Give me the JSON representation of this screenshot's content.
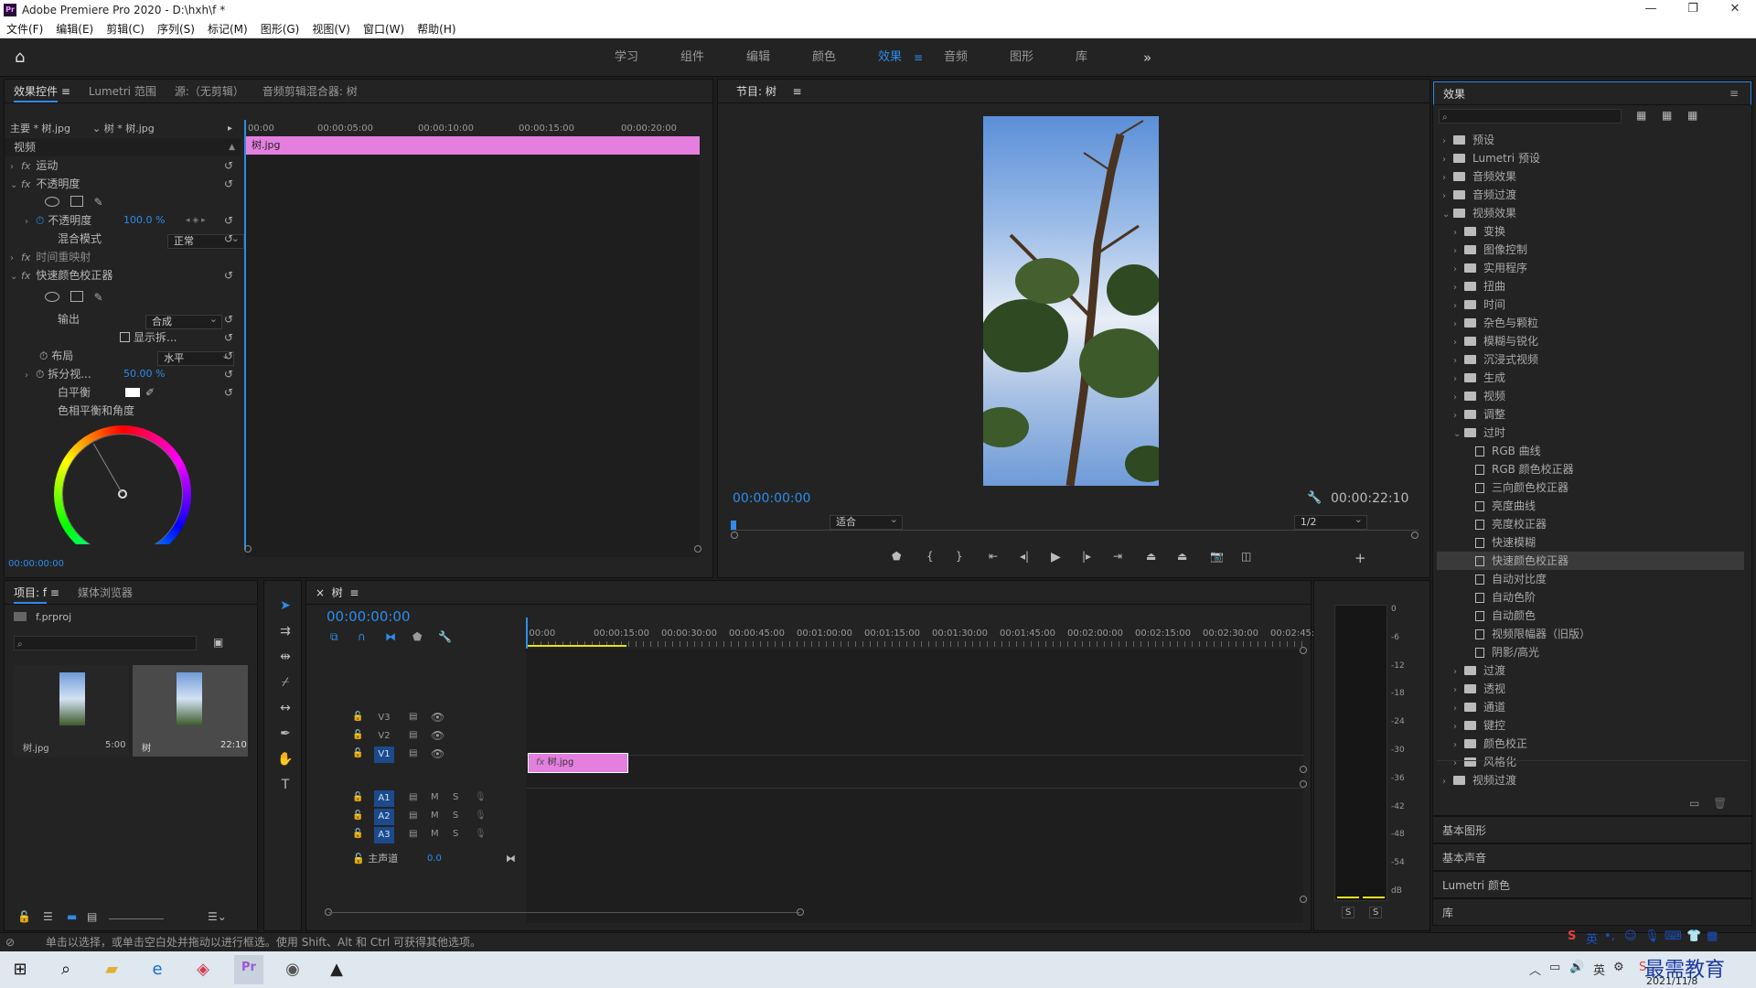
{
  "app": {
    "title": "Adobe Premiere Pro 2020 - D:\\hxh\\f *",
    "icon": "Pr"
  },
  "window_buttons": [
    "—",
    "❐",
    "✕"
  ],
  "menu": [
    "文件(F)",
    "编辑(E)",
    "剪辑(C)",
    "序列(S)",
    "标记(M)",
    "图形(G)",
    "视图(V)",
    "窗口(W)",
    "帮助(H)"
  ],
  "workspaces": {
    "items": [
      "学习",
      "组件",
      "编辑",
      "颜色",
      "效果",
      "音频",
      "图形",
      "库"
    ],
    "active": "效果",
    "more": "»"
  },
  "effect_controls": {
    "tabs": [
      "效果控件",
      "Lumetri 范围",
      "源:（无剪辑）",
      "音频剪辑混合器: 树"
    ],
    "master": "主要 * 树.jpg",
    "clip": "树 * 树.jpg",
    "ruler": [
      "00:00",
      "00:00:05:00",
      "00:00:10:00",
      "00:00:15:00",
      "00:00:20:00"
    ],
    "clip_bar": "树.jpg",
    "section_video": "视频",
    "motion": "运动",
    "opacity": "不透明度",
    "opacity_prop": "不透明度",
    "opacity_value": "100.0 %",
    "blend_mode_label": "混合模式",
    "blend_mode": "正常",
    "time_remap": "时间重映射",
    "fast_color": "快速颜色校正器",
    "output_label": "输出",
    "output_value": "合成",
    "show_split": "显示拆...",
    "layout_label": "布局",
    "layout_value": "水平",
    "split_label": "拆分视...",
    "split_value": "50.00 %",
    "white_balance": "白平衡",
    "hue_balance": "色相平衡和角度",
    "timecode": "00:00:00:00",
    "fx": "fx"
  },
  "program": {
    "title": "节目: 树",
    "timecode": "00:00:00:00",
    "fit": "适合",
    "quality": "1/2",
    "duration": "00:00:22:10"
  },
  "effects_panel": {
    "title": "效果",
    "search_placeholder": "",
    "items": [
      {
        "label": "预设",
        "level": 0,
        "type": "folder"
      },
      {
        "label": "Lumetri 预设",
        "level": 0,
        "type": "folder"
      },
      {
        "label": "音频效果",
        "level": 0,
        "type": "folder"
      },
      {
        "label": "音频过渡",
        "level": 0,
        "type": "folder"
      },
      {
        "label": "视频效果",
        "level": 0,
        "type": "folder",
        "open": true
      },
      {
        "label": "变换",
        "level": 1,
        "type": "folder"
      },
      {
        "label": "图像控制",
        "level": 1,
        "type": "folder"
      },
      {
        "label": "实用程序",
        "level": 1,
        "type": "folder"
      },
      {
        "label": "扭曲",
        "level": 1,
        "type": "folder"
      },
      {
        "label": "时间",
        "level": 1,
        "type": "folder"
      },
      {
        "label": "杂色与颗粒",
        "level": 1,
        "type": "folder"
      },
      {
        "label": "模糊与锐化",
        "level": 1,
        "type": "folder"
      },
      {
        "label": "沉浸式视频",
        "level": 1,
        "type": "folder"
      },
      {
        "label": "生成",
        "level": 1,
        "type": "folder"
      },
      {
        "label": "视频",
        "level": 1,
        "type": "folder"
      },
      {
        "label": "调整",
        "level": 1,
        "type": "folder"
      },
      {
        "label": "过时",
        "level": 1,
        "type": "folder",
        "open": true
      },
      {
        "label": "RGB 曲线",
        "level": 2,
        "type": "file"
      },
      {
        "label": "RGB 颜色校正器",
        "level": 2,
        "type": "file"
      },
      {
        "label": "三向颜色校正器",
        "level": 2,
        "type": "file"
      },
      {
        "label": "亮度曲线",
        "level": 2,
        "type": "file"
      },
      {
        "label": "亮度校正器",
        "level": 2,
        "type": "file"
      },
      {
        "label": "快速模糊",
        "level": 2,
        "type": "file"
      },
      {
        "label": "快速颜色校正器",
        "level": 2,
        "type": "file",
        "highlight": true
      },
      {
        "label": "自动对比度",
        "level": 2,
        "type": "file"
      },
      {
        "label": "自动色阶",
        "level": 2,
        "type": "file"
      },
      {
        "label": "自动颜色",
        "level": 2,
        "type": "file"
      },
      {
        "label": "视频限幅器（旧版）",
        "level": 2,
        "type": "file"
      },
      {
        "label": "阴影/高光",
        "level": 2,
        "type": "file"
      },
      {
        "label": "过渡",
        "level": 1,
        "type": "folder"
      },
      {
        "label": "透视",
        "level": 1,
        "type": "folder"
      },
      {
        "label": "通道",
        "level": 1,
        "type": "folder"
      },
      {
        "label": "键控",
        "level": 1,
        "type": "folder"
      },
      {
        "label": "颜色校正",
        "level": 1,
        "type": "folder"
      },
      {
        "label": "风格化",
        "level": 1,
        "type": "folder"
      },
      {
        "label": "视频过渡",
        "level": 0,
        "type": "folder"
      }
    ],
    "collapsed_panels": [
      "基本图形",
      "基本声音",
      "Lumetri 颜色",
      "库"
    ]
  },
  "project": {
    "tabs": [
      "项目: f",
      "媒体浏览器"
    ],
    "file": "f.prproj",
    "items": [
      {
        "name": "树.jpg",
        "duration": "5:00"
      },
      {
        "name": "树",
        "duration": "22:10"
      }
    ]
  },
  "timeline": {
    "timecode": "00:00:00:00",
    "ruler": [
      ":00:00",
      "00:00:15:00",
      "00:00:30:00",
      "00:00:45:00",
      "00:01:00:00",
      "00:01:15:00",
      "00:01:30:00",
      "00:01:45:00",
      "00:02:00:00",
      "00:02:15:00",
      "00:02:30:00",
      "00:02:45:"
    ],
    "video_tracks": [
      "V3",
      "V2",
      "V1"
    ],
    "audio_tracks": [
      "A1",
      "A2",
      "A3"
    ],
    "master_label": "主声道",
    "master_value": "0.0",
    "clip": "树.jpg",
    "M": "M",
    "S": "S"
  },
  "meter": {
    "scale": [
      "0",
      "-6",
      "-12",
      "-18",
      "-24",
      "-30",
      "-36",
      "-42",
      "-48",
      "-54",
      "dB"
    ],
    "buttons": [
      "S",
      "S"
    ]
  },
  "status": "单击以选择，或单击空白处并拖动以进行框选。使用 Shift、Alt 和 Ctrl 可获得其他选项。",
  "tray": {
    "ime": "英",
    "date": "2021/11/8",
    "watermark": "最需教育"
  },
  "colors": {
    "accent": "#2d8ceb",
    "clip_pink": "#e47fe0",
    "panel_bg": "#232323"
  }
}
